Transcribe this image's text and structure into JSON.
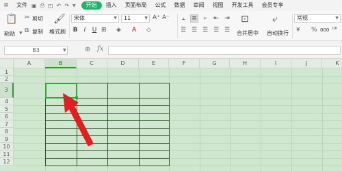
{
  "menubar": {
    "file": "文件",
    "tabs": [
      "开始",
      "插入",
      "页面布局",
      "公式",
      "数据",
      "审阅",
      "视图",
      "开发工具",
      "会员专享"
    ]
  },
  "ribbon": {
    "cut": "剪切",
    "copy": "复制",
    "paste": "粘贴",
    "format_painter": "格式刷",
    "font_name": "宋体",
    "font_size": "11",
    "bold": "B",
    "italic": "I",
    "underline": "U",
    "merge_center": "合并居中",
    "wrap_text": "自动换行",
    "number_format": "常规",
    "percent": "%",
    "thousands": "000"
  },
  "formula_bar": {
    "name_box": "B3",
    "fx": "fx",
    "value": ""
  },
  "sheet": {
    "columns": [
      "A",
      "B",
      "C",
      "D",
      "E",
      "F",
      "G",
      "H",
      "I",
      "J",
      "K"
    ],
    "rows": [
      "1",
      "2",
      "3",
      "4",
      "5",
      "6",
      "7",
      "8",
      "9",
      "10",
      "11",
      "12"
    ],
    "selected_cell": "B3"
  },
  "colors": {
    "accent": "#1fb36b",
    "sheet_bg": "#cfe6cf",
    "table_border": "#2f4f2f",
    "arrow": "#e02020"
  }
}
